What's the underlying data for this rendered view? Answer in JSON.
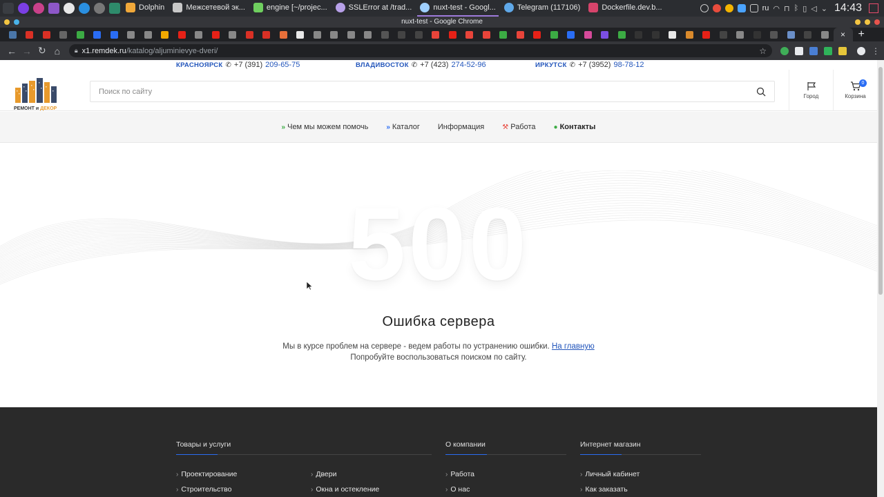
{
  "os": {
    "tasks": [
      {
        "label": "Dolphin",
        "color": "#f0a83a"
      },
      {
        "label": "Межсетевой эк...",
        "color": "#c8c8c8"
      },
      {
        "label": "engine [~/projec...",
        "color": "#6fcf5f"
      },
      {
        "label": "SSLError at /trad...",
        "color": "#b7a0e8"
      },
      {
        "label": "nuxt-test - Googl...",
        "color": "#9fd0ff",
        "active": true
      },
      {
        "label": "Telegram (117106)",
        "color": "#5fa8e8"
      },
      {
        "label": "Dockerfile.dev.b...",
        "color": "#d6446b"
      }
    ],
    "lang": "ru",
    "clock": "14:43"
  },
  "browser": {
    "window_title": "nuxt-test - Google Chrome",
    "url_host": "x1.remdek.ru",
    "url_path": "/katalog/aljuminievye-dveri/"
  },
  "phones": [
    {
      "city": "КРАСНОЯРСК",
      "prefix": "+7 (391)",
      "number": "209-65-75"
    },
    {
      "city": "ВЛАДИВОСТОК",
      "prefix": "+7 (423)",
      "number": "274-52-96"
    },
    {
      "city": "ИРКУТСК",
      "prefix": "+7 (3952)",
      "number": "98-78-12"
    }
  ],
  "header": {
    "logo_text": "РЕМОНТ и ",
    "logo_accent": "ДЕКОР",
    "search_placeholder": "Поиск по сайту",
    "city_label": "Город",
    "cart_label": "Корзина",
    "cart_count": "0"
  },
  "nav": {
    "help": "Чем мы можем помочь",
    "catalog": "Каталог",
    "info": "Информация",
    "work": "Работа",
    "contacts": "Контакты"
  },
  "error": {
    "code": "500",
    "title": "Ошибка сервера",
    "text": "Мы в курсе проблем на сервере - ведем работы по устранению ошибки. ",
    "home_link": "На главную",
    "hint": "Попробуйте воспользоваться поиском по сайту."
  },
  "footer": {
    "col1": {
      "title": "Товары и услуги",
      "a": [
        "Проектирование",
        "Строительство"
      ],
      "b": [
        "Двери",
        "Окна и остекление"
      ]
    },
    "col2": {
      "title": "О компании",
      "items": [
        "Работа",
        "О нас"
      ]
    },
    "col3": {
      "title": "Интернет магазин",
      "items": [
        "Личный кабинет",
        "Как заказать"
      ]
    }
  },
  "colors": {
    "accent": "#2255bb",
    "footer_bg": "#2a2a2a",
    "badge": "#2a6df4"
  }
}
